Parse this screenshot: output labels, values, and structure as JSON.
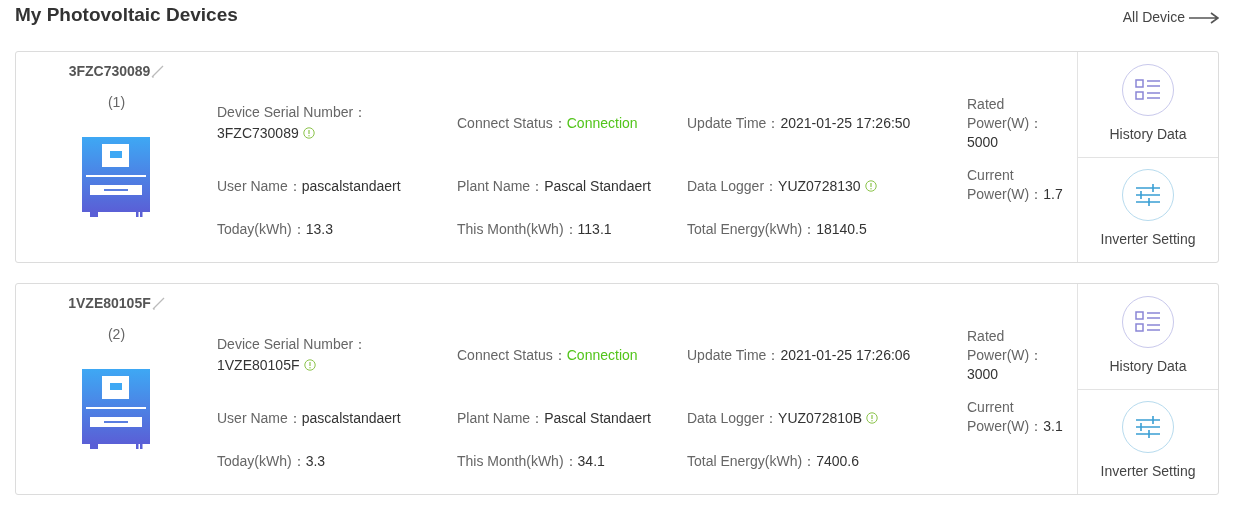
{
  "title": "My Photovoltaic Devices",
  "all_link": "All Device",
  "devices": [
    {
      "name": "3FZC730089",
      "index": "(1)",
      "fields": [
        {
          "kind": "serial",
          "label": "Device Serial Number：",
          "value": "3FZC730089",
          "info": true
        },
        {
          "kind": "status",
          "label": "Connect Status：",
          "value": "Connection",
          "info": false
        },
        {
          "kind": "plain",
          "label": "Update Time：",
          "value": "2021-01-25 17:26:50",
          "info": false
        },
        {
          "kind": "plain",
          "label": "User Name：",
          "value": "pascalstandaert",
          "info": false
        },
        {
          "kind": "plain",
          "label": "Plant Name：",
          "value": "Pascal Standaert",
          "info": false
        },
        {
          "kind": "plain",
          "label": "Data Logger：",
          "value": "YUZ0728130",
          "info": true
        },
        {
          "kind": "plain",
          "label": "Today(kWh)：",
          "value": "13.3",
          "info": false
        },
        {
          "kind": "plain",
          "label": "This Month(kWh)：",
          "value": "113.1",
          "info": false
        },
        {
          "kind": "plain",
          "label": "Total Energy(kWh)：",
          "value": "18140.5",
          "info": false
        }
      ],
      "power": [
        {
          "label": "Rated Power(W)：",
          "value": "5000"
        },
        {
          "label": "Current Power(W)：",
          "value": "1.7"
        }
      ],
      "actions": [
        {
          "kind": "history",
          "label": "History Data"
        },
        {
          "kind": "setting",
          "label": "Inverter Setting"
        }
      ]
    },
    {
      "name": "1VZE80105F",
      "index": "(2)",
      "fields": [
        {
          "kind": "serial",
          "label": "Device Serial Number：",
          "value": "1VZE80105F",
          "info": true
        },
        {
          "kind": "status",
          "label": "Connect Status：",
          "value": "Connection",
          "info": false
        },
        {
          "kind": "plain",
          "label": "Update Time：",
          "value": "2021-01-25 17:26:06",
          "info": false
        },
        {
          "kind": "plain",
          "label": "User Name：",
          "value": "pascalstandaert",
          "info": false
        },
        {
          "kind": "plain",
          "label": "Plant Name：",
          "value": "Pascal Standaert",
          "info": false
        },
        {
          "kind": "plain",
          "label": "Data Logger：",
          "value": "YUZ072810B",
          "info": true
        },
        {
          "kind": "plain",
          "label": "Today(kWh)：",
          "value": "3.3",
          "info": false
        },
        {
          "kind": "plain",
          "label": "This Month(kWh)：",
          "value": "34.1",
          "info": false
        },
        {
          "kind": "plain",
          "label": "Total Energy(kWh)：",
          "value": "7400.6",
          "info": false
        }
      ],
      "power": [
        {
          "label": "Rated Power(W)：",
          "value": "3000"
        },
        {
          "label": "Current Power(W)：",
          "value": "3.1"
        }
      ],
      "actions": [
        {
          "kind": "history",
          "label": "History Data"
        },
        {
          "kind": "setting",
          "label": "Inverter Setting"
        }
      ]
    }
  ]
}
